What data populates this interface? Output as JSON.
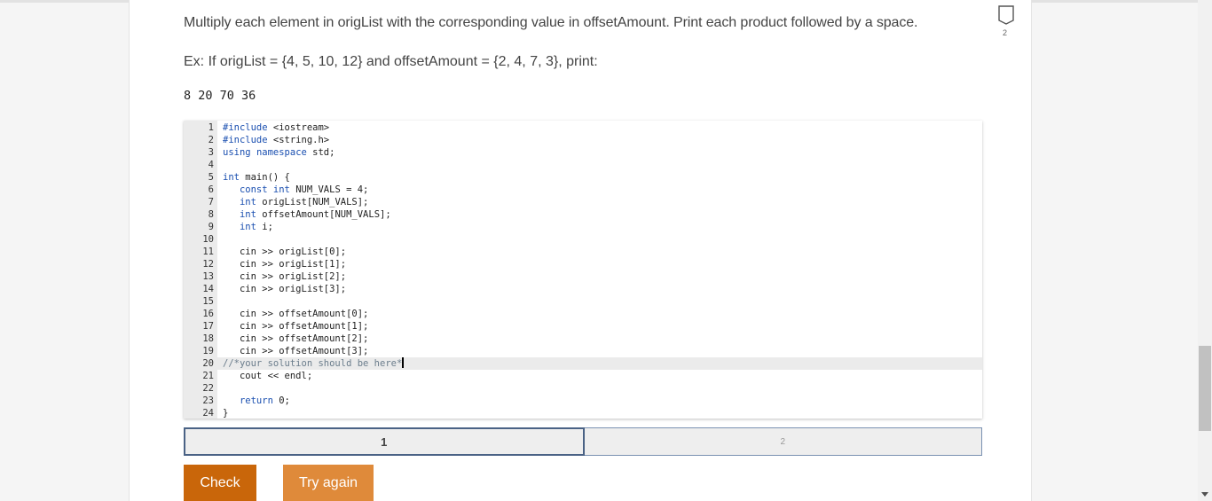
{
  "question": {
    "prompt": "Multiply each element in origList with the corresponding value in offsetAmount. Print each product followed by a space.",
    "example": "Ex: If origList = {4, 5, 10, 12} and offsetAmount = {2, 4, 7, 3}, print:",
    "expected_output": "8 20 70 36",
    "flag_number": "2"
  },
  "editor": {
    "lines": [
      {
        "n": "1",
        "code": "#include <iostream>"
      },
      {
        "n": "2",
        "code": "#include <string.h>"
      },
      {
        "n": "3",
        "code": "using namespace std;"
      },
      {
        "n": "4",
        "code": ""
      },
      {
        "n": "5",
        "code": "int main() {"
      },
      {
        "n": "6",
        "code": "   const int NUM_VALS = 4;"
      },
      {
        "n": "7",
        "code": "   int origList[NUM_VALS];"
      },
      {
        "n": "8",
        "code": "   int offsetAmount[NUM_VALS];"
      },
      {
        "n": "9",
        "code": "   int i;"
      },
      {
        "n": "10",
        "code": ""
      },
      {
        "n": "11",
        "code": "   cin >> origList[0];"
      },
      {
        "n": "12",
        "code": "   cin >> origList[1];"
      },
      {
        "n": "13",
        "code": "   cin >> origList[2];"
      },
      {
        "n": "14",
        "code": "   cin >> origList[3];"
      },
      {
        "n": "15",
        "code": ""
      },
      {
        "n": "16",
        "code": "   cin >> offsetAmount[0];"
      },
      {
        "n": "17",
        "code": "   cin >> offsetAmount[1];"
      },
      {
        "n": "18",
        "code": "   cin >> offsetAmount[2];"
      },
      {
        "n": "19",
        "code": "   cin >> offsetAmount[3];"
      },
      {
        "n": "20",
        "code": "//*your solution should be here*"
      },
      {
        "n": "21",
        "code": "   cout << endl;"
      },
      {
        "n": "22",
        "code": ""
      },
      {
        "n": "23",
        "code": "   return 0;"
      },
      {
        "n": "24",
        "code": "}"
      }
    ],
    "active_line": "20"
  },
  "progress": {
    "segments": [
      {
        "label": "1",
        "current": true
      },
      {
        "label": "2",
        "current": false
      }
    ]
  },
  "buttons": {
    "check": "Check",
    "try_again": "Try again"
  },
  "colors": {
    "check": "#c9660a",
    "try_again": "#df8a3a",
    "progress_border": "#4a6285"
  }
}
